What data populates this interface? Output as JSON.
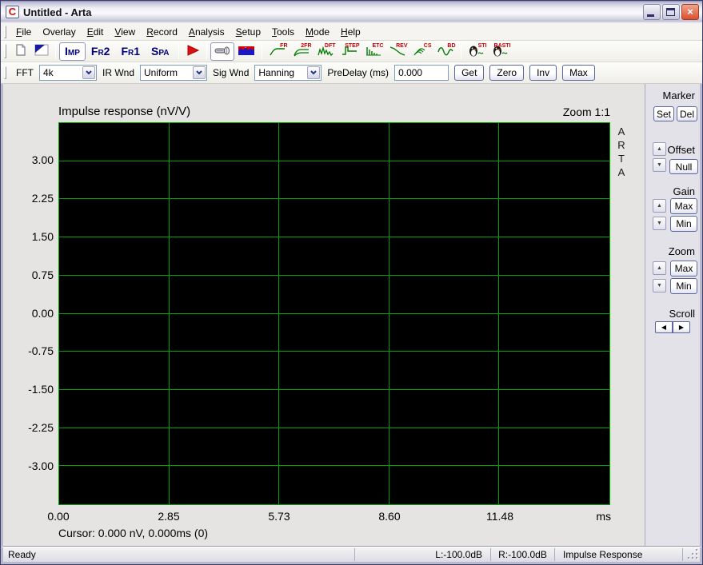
{
  "window": {
    "title": "Untitled - Arta"
  },
  "titlebar_buttons": {
    "close_glyph": "×"
  },
  "menu": {
    "items": [
      {
        "label": "File",
        "underline": 0
      },
      {
        "label": "Overlay",
        "underline": -1
      },
      {
        "label": "Edit",
        "underline": 0
      },
      {
        "label": "View",
        "underline": 0
      },
      {
        "label": "Record",
        "underline": 0
      },
      {
        "label": "Analysis",
        "underline": 0
      },
      {
        "label": "Setup",
        "underline": 0
      },
      {
        "label": "Tools",
        "underline": 0
      },
      {
        "label": "Mode",
        "underline": 0
      },
      {
        "label": "Help",
        "underline": 0
      }
    ]
  },
  "toolbar1": {
    "groups": [
      {
        "buttons": [
          {
            "name": "new-document",
            "icon": "new-document-icon"
          },
          {
            "name": "overlay-flag",
            "icon": "overlay-flag-icon"
          }
        ]
      },
      {
        "buttons": [
          {
            "name": "imp-mode",
            "label": "Imp",
            "active": true
          },
          {
            "name": "fr2-mode",
            "label": "Fr2"
          },
          {
            "name": "fr1-mode",
            "label": "Fr1"
          },
          {
            "name": "spa-mode",
            "label": "Spa"
          }
        ]
      },
      {
        "buttons": [
          {
            "name": "record-play",
            "icon": "play-icon"
          }
        ]
      },
      {
        "buttons": [
          {
            "name": "microphone",
            "icon": "microphone-icon",
            "active": true
          },
          {
            "name": "signal-generator",
            "icon": "signal-generator-icon"
          }
        ]
      },
      {
        "buttons": [
          {
            "name": "fr-analysis",
            "icon": "fr-curve-icon",
            "badge": "FR"
          },
          {
            "name": "2fr-analysis",
            "icon": "2fr-curve-icon",
            "badge": "2FR"
          },
          {
            "name": "dft-analysis",
            "icon": "dft-curve-icon",
            "badge": "DFT"
          },
          {
            "name": "step-analysis",
            "icon": "step-curve-icon",
            "badge": "STEP"
          },
          {
            "name": "etc-analysis",
            "icon": "etc-curve-icon",
            "badge": "ETC"
          },
          {
            "name": "rev-analysis",
            "icon": "rev-curve-icon",
            "badge": "REV"
          },
          {
            "name": "cs-analysis",
            "icon": "cs-curve-icon",
            "badge": "CS"
          },
          {
            "name": "bd-analysis",
            "icon": "bd-curve-icon",
            "badge": "BD"
          }
        ]
      },
      {
        "buttons": [
          {
            "name": "sti-analysis",
            "icon": "sti-penguin-icon",
            "badge": "STI"
          },
          {
            "name": "rasti-analysis",
            "icon": "rasti-penguin-icon",
            "badge": "RASTI"
          }
        ]
      }
    ]
  },
  "toolbar2": {
    "fft_label": "FFT",
    "fft_value": "4k",
    "irwnd_label": "IR Wnd",
    "irwnd_value": "Uniform",
    "sigwnd_label": "Sig Wnd",
    "sigwnd_value": "Hanning",
    "predelay_label": "PreDelay (ms)",
    "predelay_value": "0.000",
    "get_label": "Get",
    "zero_label": "Zero",
    "inv_label": "Inv",
    "max_label": "Max"
  },
  "chart_data": {
    "type": "line",
    "title": "Impulse response (nV/V)",
    "zoom_indicator": "Zoom 1:1",
    "watermark": "ARTA",
    "xlabel": "ms",
    "x_unit": "ms",
    "x_ticks": [
      "0.00",
      "2.85",
      "5.73",
      "8.60",
      "11.48"
    ],
    "y_ticks": [
      "3.00",
      "2.25",
      "1.50",
      "0.75",
      "0.00",
      "-0.75",
      "-1.50",
      "-2.25",
      "-3.00"
    ],
    "ylim": [
      -3.75,
      3.75
    ],
    "xlim": [
      0,
      14.33
    ],
    "grid": true,
    "legend": "none",
    "plot_bg": "#000000",
    "grid_color": "#00a400",
    "series": [
      {
        "name": "impulse-response",
        "values": []
      }
    ],
    "cursor_readout": "Cursor: 0.000 nV, 0.000ms (0)"
  },
  "side_panel": {
    "marker_label": "Marker",
    "set_label": "Set",
    "del_label": "Del",
    "offset_label": "Offset",
    "null_label": "Null",
    "gain_label": "Gain",
    "gain_max_label": "Max",
    "gain_min_label": "Min",
    "zoom_label": "Zoom",
    "zoom_max_label": "Max",
    "zoom_min_label": "Min",
    "scroll_label": "Scroll"
  },
  "statusbar": {
    "ready": "Ready",
    "l_level": "L:-100.0dB",
    "r_level": "R:-100.0dB",
    "mode": "Impulse Response"
  }
}
